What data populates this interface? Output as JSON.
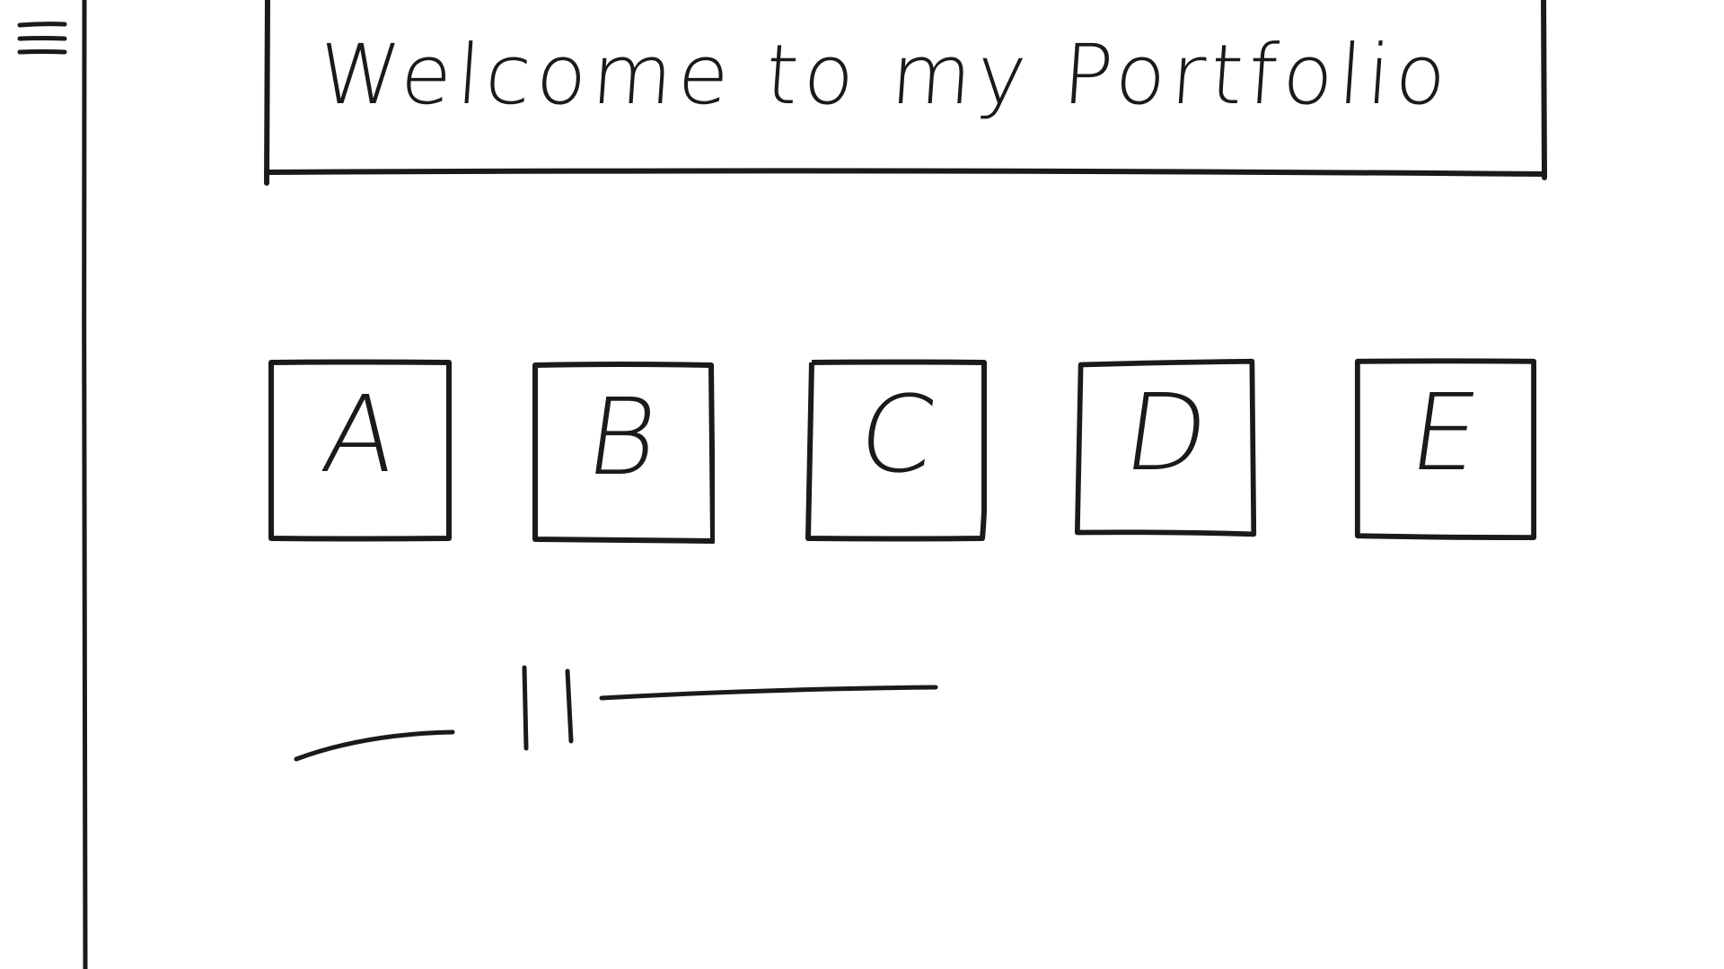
{
  "header": {
    "title": "Welcome to my Portfolio"
  },
  "tiles": [
    {
      "label": "A"
    },
    {
      "label": "B"
    },
    {
      "label": "C"
    },
    {
      "label": "D"
    },
    {
      "label": "E"
    }
  ],
  "colors": {
    "ink": "#1a1a1a",
    "background": "#ffffff"
  },
  "icons": {
    "menu": "hamburger-menu-icon",
    "slider_handle": "slider-handle-icon"
  }
}
